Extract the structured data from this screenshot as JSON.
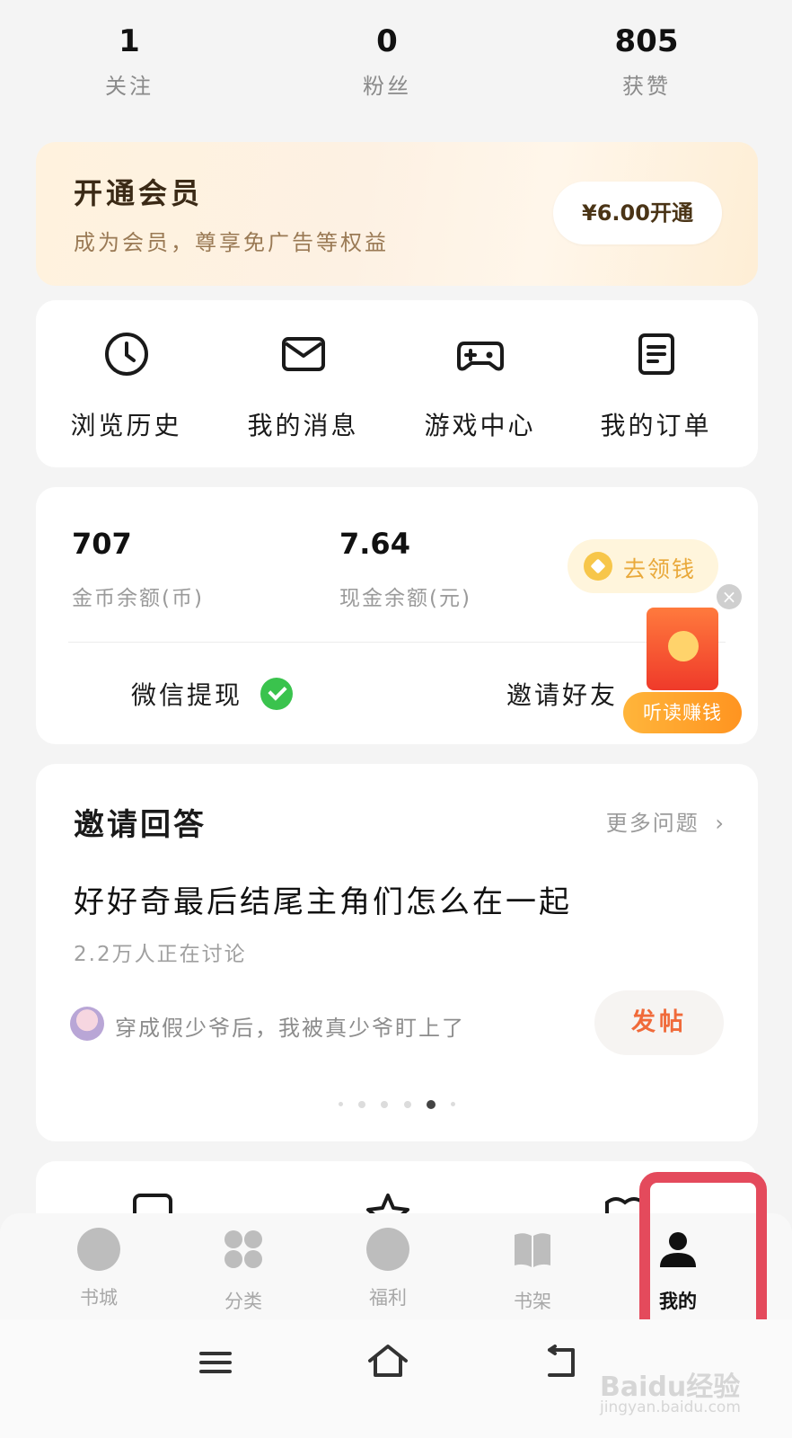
{
  "stats": [
    {
      "value": "1",
      "label": "关注"
    },
    {
      "value": "0",
      "label": "粉丝"
    },
    {
      "value": "805",
      "label": "获赞"
    }
  ],
  "vip": {
    "title": "开通会员",
    "subtitle": "成为会员，尊享免广告等权益",
    "button": "¥6.00开通"
  },
  "quick_actions": [
    {
      "label": "浏览历史",
      "icon": "clock-icon"
    },
    {
      "label": "我的消息",
      "icon": "mail-icon"
    },
    {
      "label": "游戏中心",
      "icon": "gamepad-icon"
    },
    {
      "label": "我的订单",
      "icon": "order-icon"
    }
  ],
  "wallet": {
    "coins": "707",
    "coins_label": "金币余额(币)",
    "cash": "7.64",
    "cash_label": "现金余额(元)",
    "earn_button": "去领钱",
    "withdraw": "微信提现",
    "invite": "邀请好友"
  },
  "floating": {
    "close": "×",
    "listen_earn": "听读赚钱"
  },
  "invite_answer": {
    "title": "邀请回答",
    "more": "更多问题",
    "question": "好好奇最后结尾主角们怎么在一起",
    "discussion": "2.2万人正在讨论",
    "book": "穿成假少爷后，我被真少爷盯上了",
    "post_button": "发帖",
    "pager": {
      "count": 6,
      "active_index": 4
    }
  },
  "bottom_nav": [
    {
      "label": "书城",
      "icon": "compass-icon",
      "active": false
    },
    {
      "label": "分类",
      "icon": "grid-icon",
      "active": false
    },
    {
      "label": "福利",
      "icon": "gift-icon",
      "active": false
    },
    {
      "label": "书架",
      "icon": "book-icon",
      "active": false
    },
    {
      "label": "我的",
      "icon": "person-icon",
      "active": true
    }
  ],
  "system_nav": [
    "menu-icon",
    "home-icon",
    "back-icon"
  ],
  "watermark": {
    "brand": "Baidu经验",
    "url": "jingyan.baidu.com"
  },
  "colors": {
    "accent_red": "#e44a5c",
    "earn_orange": "#ff9420",
    "post_orange": "#f06a3a"
  }
}
